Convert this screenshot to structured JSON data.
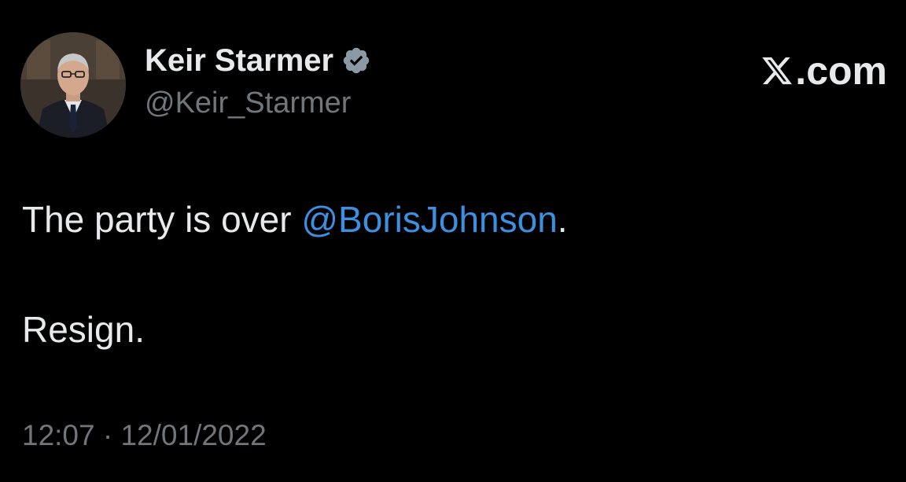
{
  "author": {
    "display_name": "Keir Starmer",
    "handle": "@Keir_Starmer",
    "verified": true,
    "verified_icon": "verified-badge-icon",
    "avatar": "profile-photo"
  },
  "brand": {
    "logo": "x-logo-icon",
    "text": ".com"
  },
  "tweet": {
    "line1_prefix": "The party is over ",
    "mention": "@BorisJohnson",
    "line1_suffix": ".",
    "line2": "Resign."
  },
  "meta": {
    "time": "12:07",
    "separator": " · ",
    "date": "12/01/2022"
  },
  "colors": {
    "background": "#000000",
    "text": "#e7e9ea",
    "muted": "#71767b",
    "link": "#3d8fe0",
    "badge": "#8b98a5"
  }
}
